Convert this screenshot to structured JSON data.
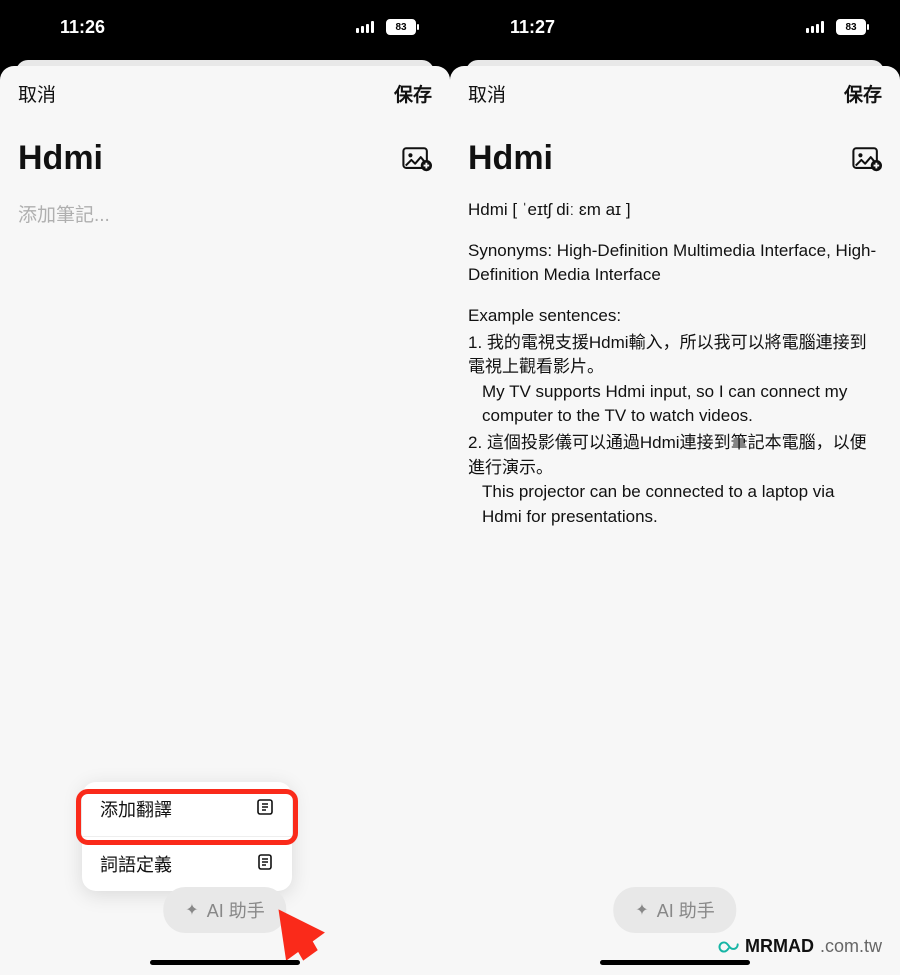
{
  "left": {
    "status": {
      "time": "11:26",
      "battery": "83"
    },
    "header": {
      "cancel": "取消",
      "save": "保存"
    },
    "title": "Hdmi",
    "placeholder": "添加筆記...",
    "popup": {
      "item1": {
        "label": "添加翻譯"
      },
      "item2": {
        "label": "詞語定義"
      }
    },
    "ai_button": "AI 助手"
  },
  "right": {
    "status": {
      "time": "11:27",
      "battery": "83"
    },
    "header": {
      "cancel": "取消",
      "save": "保存"
    },
    "title": "Hdmi",
    "note": {
      "pron": "Hdmi [ ˈeɪtʃ diː ɛm aɪ ]",
      "syn": "Synonyms: High-Definition Multimedia Interface, High-Definition Media Interface",
      "ex_label": "Example sentences:",
      "ex1_zh": "1. 我的電視支援Hdmi輸入，所以我可以將電腦連接到電視上觀看影片。",
      "ex1_en": "My TV supports Hdmi input, so I can connect my computer to the TV to watch videos.",
      "ex2_zh": "2. 這個投影儀可以通過Hdmi連接到筆記本電腦，以便進行演示。",
      "ex2_en": "This projector can be connected to a laptop via Hdmi for presentations."
    },
    "ai_button": "AI 助手"
  },
  "watermark": {
    "brand": "MRMAD",
    "domain": ".com.tw"
  }
}
